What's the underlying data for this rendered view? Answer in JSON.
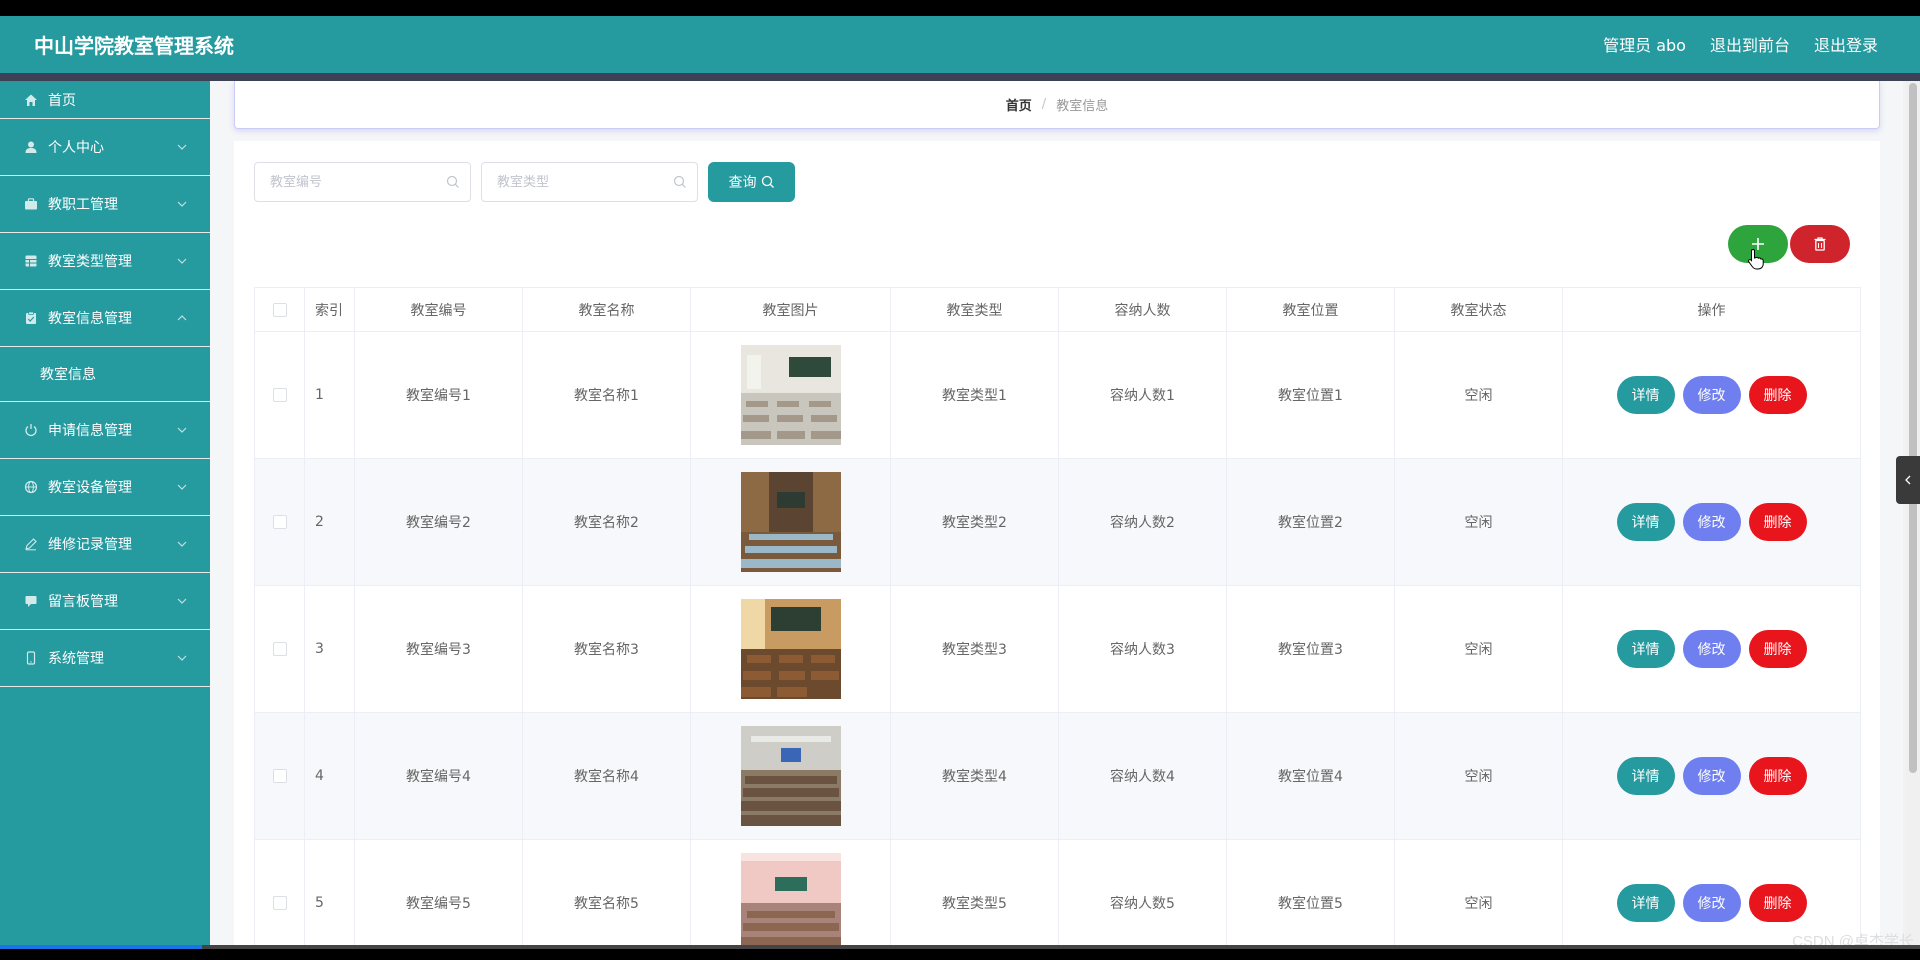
{
  "app": {
    "title": "中山学院教室管理系统"
  },
  "header_links": {
    "user": "管理员 abo",
    "to_front": "退出到前台",
    "logout": "退出登录"
  },
  "sidebar": {
    "items": [
      {
        "label": "首页"
      },
      {
        "label": "个人中心"
      },
      {
        "label": "教职工管理"
      },
      {
        "label": "教室类型管理"
      },
      {
        "label": "教室信息管理"
      },
      {
        "label": "申请信息管理"
      },
      {
        "label": "教室设备管理"
      },
      {
        "label": "维修记录管理"
      },
      {
        "label": "留言板管理"
      },
      {
        "label": "系统管理"
      }
    ],
    "submenu": {
      "label": "教室信息"
    }
  },
  "breadcrumb": {
    "home": "首页",
    "sep": "/",
    "current": "教室信息"
  },
  "search": {
    "code_placeholder": "教室编号",
    "type_placeholder": "教室类型",
    "query_label": "查询"
  },
  "table": {
    "headers": [
      "索引",
      "教室编号",
      "教室名称",
      "教室图片",
      "教室类型",
      "容纳人数",
      "教室位置",
      "教室状态",
      "操作"
    ],
    "rows": [
      {
        "index": "1",
        "code": "教室编号1",
        "name": "教室名称1",
        "type": "教室类型1",
        "capacity": "容纳人数1",
        "location": "教室位置1",
        "status": "空闲"
      },
      {
        "index": "2",
        "code": "教室编号2",
        "name": "教室名称2",
        "type": "教室类型2",
        "capacity": "容纳人数2",
        "location": "教室位置2",
        "status": "空闲"
      },
      {
        "index": "3",
        "code": "教室编号3",
        "name": "教室名称3",
        "type": "教室类型3",
        "capacity": "容纳人数3",
        "location": "教室位置3",
        "status": "空闲"
      },
      {
        "index": "4",
        "code": "教室编号4",
        "name": "教室名称4",
        "type": "教室类型4",
        "capacity": "容纳人数4",
        "location": "教室位置4",
        "status": "空闲"
      },
      {
        "index": "5",
        "code": "教室编号5",
        "name": "教室名称5",
        "type": "教室类型5",
        "capacity": "容纳人数5",
        "location": "教室位置5",
        "status": "空闲"
      }
    ],
    "actions": {
      "detail": "详情",
      "edit": "修改",
      "delete": "删除"
    }
  },
  "watermark": "CSDN @卓杰学长",
  "colors": {
    "primary": "#259a9f",
    "add": "#2ea43c",
    "danger": "#e8151d",
    "edit": "#6f7ff0"
  },
  "video_progress": 0.105
}
